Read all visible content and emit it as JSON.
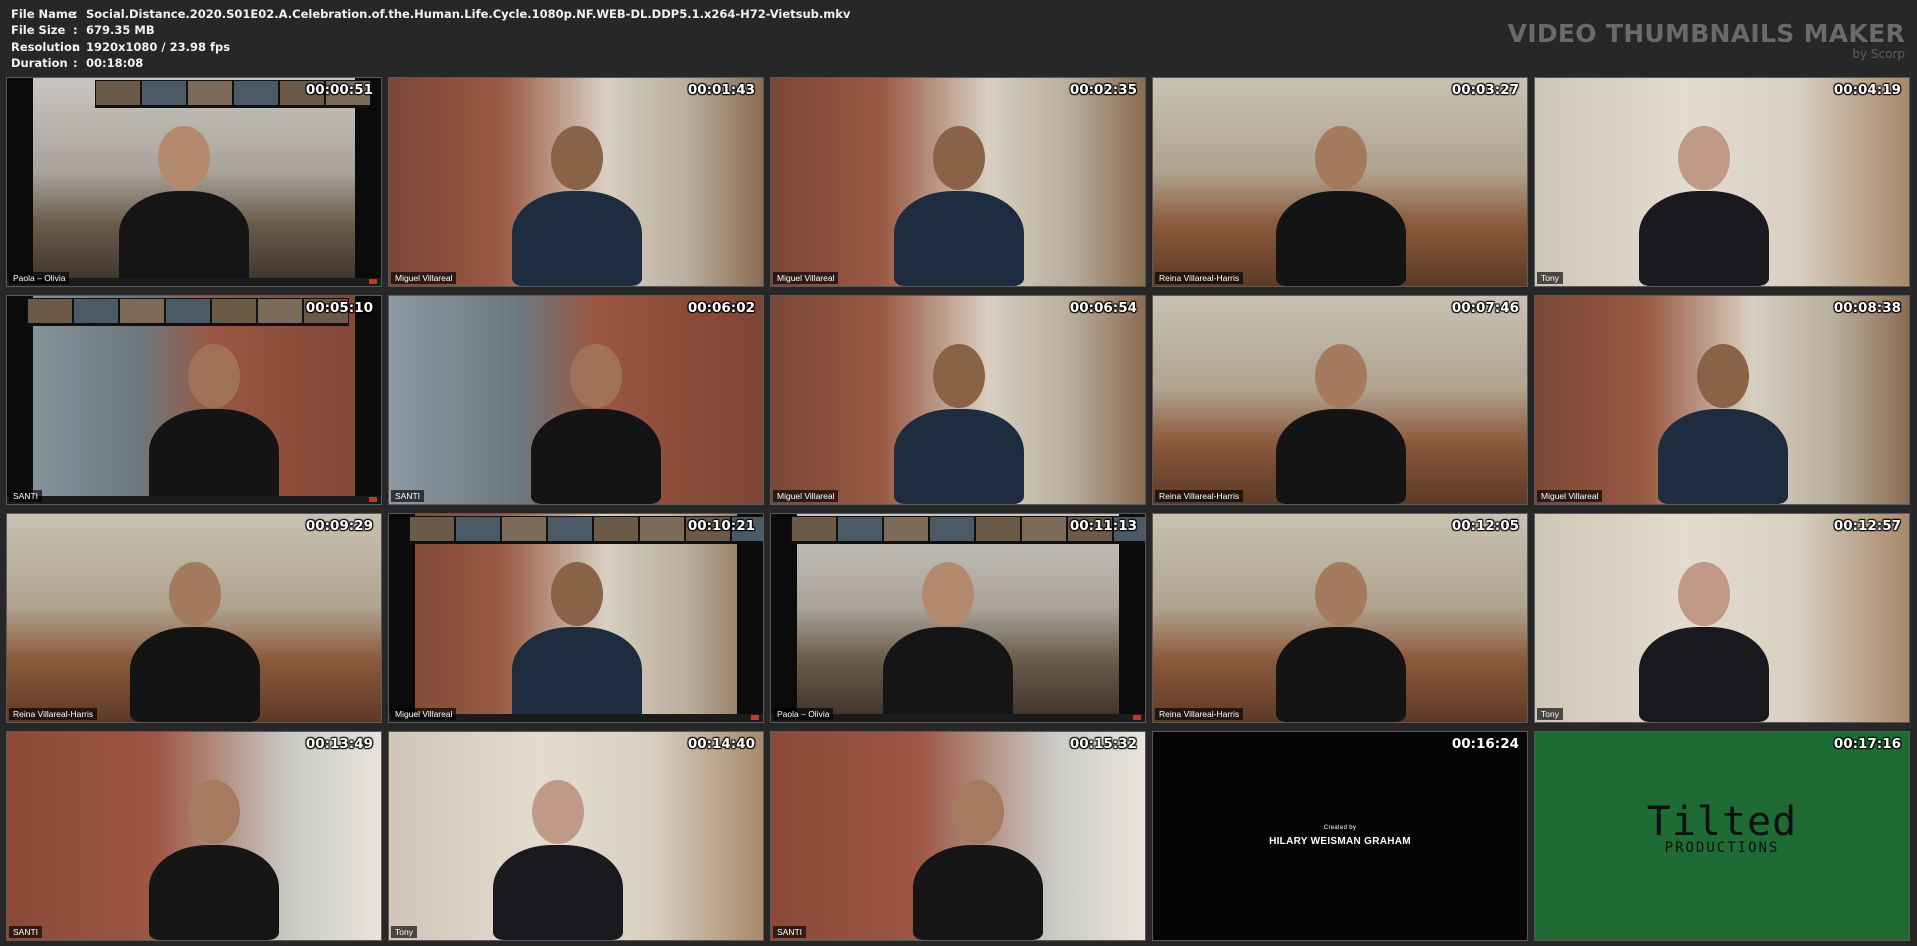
{
  "info": {
    "rows": [
      {
        "key": "File Name",
        "sep": ":",
        "value": "Social.Distance.2020.S01E02.A.Celebration.of.the.Human.Life.Cycle.1080p.NF.WEB-DL.DDP5.1.x264-H72-Vietsub.mkv"
      },
      {
        "key": "File Size",
        "sep": ":",
        "value": "679.35 MB"
      },
      {
        "key": "Resolution",
        "sep": ":",
        "value": "1920x1080 / 23.98 fps"
      },
      {
        "key": "Duration",
        "sep": ":",
        "value": "00:18:08"
      }
    ]
  },
  "brand": {
    "title": "VIDEO THUMBNAILS MAKER",
    "subtitle": "by Scorp"
  },
  "thumbnails": [
    {
      "time": "00:00:51",
      "label": "Paola – Olivia",
      "scene": "bg-lr"
    },
    {
      "time": "00:01:43",
      "label": "Miguel Villareal",
      "scene": "bg-shelf"
    },
    {
      "time": "00:02:35",
      "label": "Miguel Villareal",
      "scene": "bg-shelf"
    },
    {
      "time": "00:03:27",
      "label": "Reina Villareal-Harris",
      "scene": "bg-couch"
    },
    {
      "time": "00:04:19",
      "label": "Tony",
      "scene": "bg-books"
    },
    {
      "time": "00:05:10",
      "label": "SANTI",
      "scene": "bg-brick"
    },
    {
      "time": "00:06:02",
      "label": "SANTI",
      "scene": "bg-brick"
    },
    {
      "time": "00:06:54",
      "label": "Miguel Villareal",
      "scene": "bg-shelf"
    },
    {
      "time": "00:07:46",
      "label": "Reina Villareal-Harris",
      "scene": "bg-couch"
    },
    {
      "time": "00:08:38",
      "label": "Miguel Villareal",
      "scene": "bg-shelf"
    },
    {
      "time": "00:09:29",
      "label": "Reina Villareal-Harris",
      "scene": "bg-couch"
    },
    {
      "time": "00:10:21",
      "label": "Miguel Villareal",
      "scene": "bg-shelf"
    },
    {
      "time": "00:11:13",
      "label": "Paola – Olivia",
      "scene": "bg-lr"
    },
    {
      "time": "00:12:05",
      "label": "Reina Villareal-Harris",
      "scene": "bg-couch"
    },
    {
      "time": "00:12:57",
      "label": "Tony",
      "scene": "bg-books"
    },
    {
      "time": "00:13:49",
      "label": "SANTI",
      "scene": "bg-brick2"
    },
    {
      "time": "00:14:40",
      "label": "Tony",
      "scene": "bg-books"
    },
    {
      "time": "00:15:32",
      "label": "SANTI",
      "scene": "bg-brick2"
    },
    {
      "time": "00:16:24",
      "label": "",
      "scene": "bg-black",
      "credit_small": "Created by",
      "credit_big": "HILARY WEISMAN GRAHAM"
    },
    {
      "time": "00:17:16",
      "label": "",
      "scene": "bg-green",
      "logo_main": "Tilted",
      "logo_sub": "PRODUCTIONS"
    }
  ]
}
